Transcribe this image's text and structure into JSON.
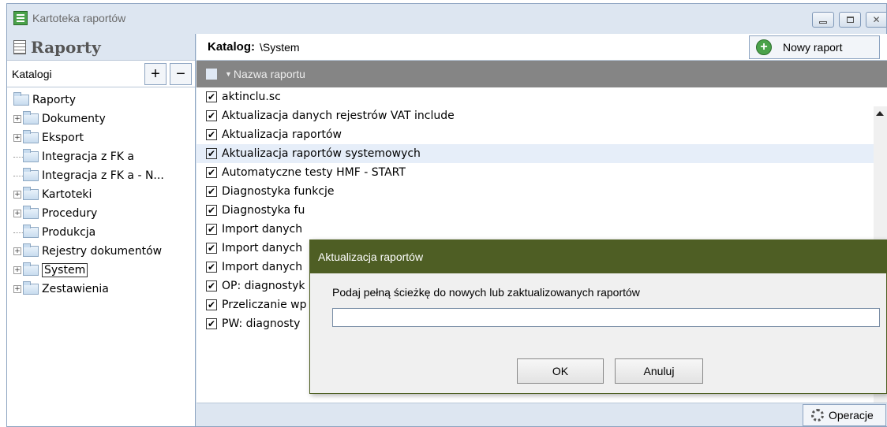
{
  "window": {
    "title": "Kartoteka raportów",
    "close_glyph": "✕"
  },
  "sidebar": {
    "title": "Raporty",
    "catalog_label": "Katalogi",
    "add_label": "+",
    "remove_label": "−",
    "tree": {
      "root": "Raporty",
      "items": [
        {
          "label": "Dokumenty",
          "expandable": true
        },
        {
          "label": "Eksport",
          "expandable": true
        },
        {
          "label": "Integracja z FK a",
          "expandable": false
        },
        {
          "label": "Integracja z FK a - N...",
          "expandable": false
        },
        {
          "label": "Kartoteki",
          "expandable": true
        },
        {
          "label": "Procedury",
          "expandable": true
        },
        {
          "label": "Produkcja",
          "expandable": false
        },
        {
          "label": "Rejestry dokumentów",
          "expandable": true
        },
        {
          "label": "System",
          "expandable": true,
          "selected": true
        },
        {
          "label": "Zestawienia",
          "expandable": true
        }
      ]
    }
  },
  "main": {
    "catalog_title": "Katalog:",
    "catalog_path": "\\System",
    "new_report_label": "Nowy raport",
    "column_header": "Nazwa raportu",
    "sort_glyph": "▼",
    "rows": [
      "aktinclu.sc",
      "Aktualizacja danych rejestrów VAT include",
      "Aktualizacja raportów",
      "Aktualizacja raportów systemowych",
      "Automatyczne testy HMF - START",
      "Diagnostyka funkcje",
      "Diagnostyka fu",
      "Import danych",
      "Import danych",
      "Import danych",
      "OP: diagnostyk",
      "Przeliczanie wp",
      "PW: diagnosty"
    ],
    "highlighted_row": 3,
    "check_glyph": "✔",
    "operations_label": "Operacje"
  },
  "dialog": {
    "title": "Aktualizacja raportów",
    "prompt": "Podaj pełną ścieżkę do nowych lub zaktualizowanych raportów",
    "input_value": "",
    "ok_label": "OK",
    "cancel_label": "Anuluj"
  },
  "colors": {
    "dialog_title_bg": "#4e5e24",
    "grid_header_bg": "#858585",
    "window_bg": "#dde6f1",
    "row_highlight": "#e6eef9"
  }
}
